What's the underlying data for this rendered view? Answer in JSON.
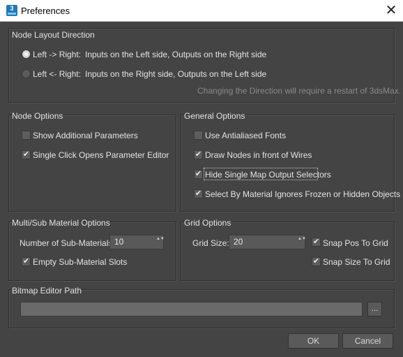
{
  "window": {
    "title": "Preferences",
    "icon": "3dsmax-app-icon",
    "icon_text": "3"
  },
  "layout_direction": {
    "title": "Node Layout Direction",
    "options": [
      {
        "label": "Left -> Right:",
        "desc": "Inputs on the Left side, Outputs on the Right side",
        "selected": true
      },
      {
        "label": "Left <- Right:",
        "desc": "Inputs on the Right side, Outputs on the Left side",
        "selected": false
      }
    ],
    "hint": "Changing the Direction will require a restart of 3dsMax."
  },
  "node_options": {
    "title": "Node Options",
    "items": [
      {
        "label": "Show Additional Parameters",
        "checked": false
      },
      {
        "label": "Single Click Opens Parameter Editor",
        "checked": true
      }
    ]
  },
  "general_options": {
    "title": "General Options",
    "items": [
      {
        "label": "Use Antialiased Fonts",
        "checked": false
      },
      {
        "label": "Draw Nodes in front of Wires",
        "checked": true
      },
      {
        "label": "Hide Single Map Output Selectors",
        "checked": true
      },
      {
        "label": "Select By Material Ignores Frozen or Hidden Objects",
        "checked": true
      }
    ]
  },
  "multisub": {
    "title": "Multi/Sub Material Options",
    "count_label": "Number of Sub-Materials:",
    "count_value": "10",
    "empty_label": "Empty Sub-Material Slots",
    "empty_checked": true
  },
  "grid": {
    "title": "Grid Options",
    "size_label": "Grid Size:",
    "size_value": "20",
    "snap_pos_label": "Snap Pos To Grid",
    "snap_pos_checked": true,
    "snap_size_label": "Snap Size To Grid",
    "snap_size_checked": true
  },
  "bitmap": {
    "title": "Bitmap Editor Path",
    "path_value": "",
    "browse_label": "..."
  },
  "buttons": {
    "ok": "OK",
    "cancel": "Cancel"
  },
  "glyphs": {
    "check": "✔",
    "close": "✕",
    "spin": "▲▼"
  }
}
